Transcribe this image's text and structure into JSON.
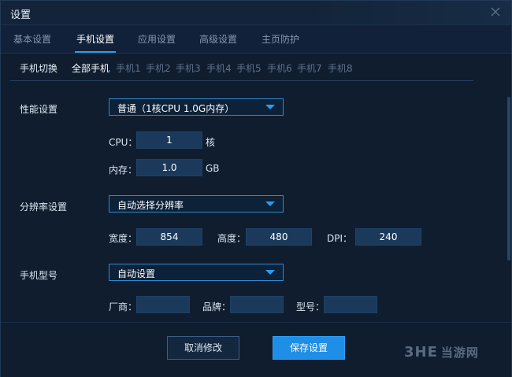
{
  "window": {
    "title": "设置"
  },
  "tabs": [
    {
      "label": "基本设置"
    },
    {
      "label": "手机设置"
    },
    {
      "label": "应用设置"
    },
    {
      "label": "高级设置"
    },
    {
      "label": "主页防护"
    }
  ],
  "active_tab": "手机设置",
  "subtabs": {
    "label": "手机切换",
    "items": [
      "全部手机",
      "手机1",
      "手机2",
      "手机3",
      "手机4",
      "手机5",
      "手机6",
      "手机7",
      "手机8"
    ],
    "active": "全部手机"
  },
  "performance": {
    "label": "性能设置",
    "dropdown_value": "普通（1核CPU 1.0G内存）",
    "cpu_label": "CPU：",
    "cpu_value": "1",
    "cpu_unit": "核",
    "mem_label": "内存：",
    "mem_value": "1.0",
    "mem_unit": "GB"
  },
  "resolution": {
    "label": "分辨率设置",
    "dropdown_value": "自动选择分辨率",
    "width_label": "宽度：",
    "width_value": "854",
    "height_label": "高度：",
    "height_value": "480",
    "dpi_label": "DPI：",
    "dpi_value": "240"
  },
  "model": {
    "label": "手机型号",
    "dropdown_value": "自动设置",
    "vendor_label": "厂商：",
    "vendor_value": "",
    "brand_label": "品牌：",
    "brand_value": "",
    "model_label": "型号：",
    "model_value": ""
  },
  "footer": {
    "cancel_label": "取消修改",
    "save_label": "保存设置"
  },
  "watermark": {
    "logo": "3HE",
    "text": "当游网"
  },
  "colors": {
    "accent": "#2b9cf0",
    "primary_button": "#1e8ee6",
    "background": "#0f1d2f"
  }
}
